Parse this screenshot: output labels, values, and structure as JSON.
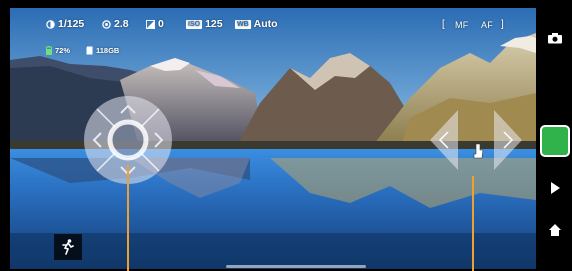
{
  "status_bar": {
    "shutter_speed": "1/125",
    "aperture": "2.8",
    "exposure_comp": "0",
    "iso_label": "ISO",
    "iso_value": "125",
    "wb_label": "WB",
    "wb_value": "Auto",
    "focus_left_bracket": "[",
    "focus_mf": "MF",
    "focus_af": "AF",
    "focus_right_bracket": "]",
    "battery_percent": "72%",
    "storage": "118GB"
  },
  "colors": {
    "accent": "#2fb34a",
    "guide_line": "#f0a030",
    "background": "#000000"
  },
  "icons": {
    "camera_switch": "camera-switch-icon",
    "play": "play-icon",
    "home": "home-icon",
    "dpad": "direction-pad",
    "zoom": "zoom-arrows",
    "person_run": "running-person-icon",
    "cursor": "hand-cursor-icon"
  }
}
